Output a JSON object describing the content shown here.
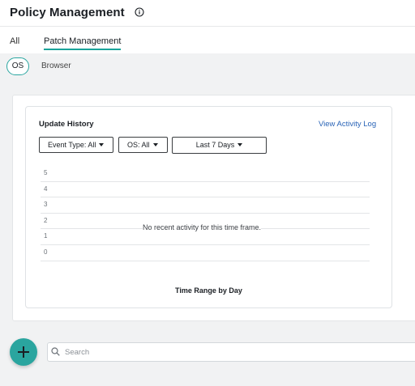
{
  "header": {
    "title": "Policy Management",
    "info_icon": "info-icon"
  },
  "tabs": [
    {
      "label": "All",
      "active": false
    },
    {
      "label": "Patch Management",
      "active": true
    }
  ],
  "subtabs": [
    {
      "label": "OS",
      "active": true
    },
    {
      "label": "Browser",
      "active": false
    }
  ],
  "update_history": {
    "title": "Update History",
    "view_activity_log": "View Activity Log",
    "filters": {
      "event_type": "Event Type: All",
      "os": "OS: All",
      "range": "Last 7 Days"
    },
    "empty_message": "No recent activity for this time frame.",
    "x_axis_title": "Time Range by Day"
  },
  "chart_data": {
    "type": "bar",
    "categories": [],
    "values": [],
    "xlabel": "Time Range by Day",
    "ylabel": "",
    "ylim": [
      0,
      5
    ],
    "yticks": [
      "5",
      "4",
      "3",
      "2",
      "1",
      "0"
    ],
    "grid": true
  },
  "fab": {
    "icon": "plus-icon"
  },
  "search": {
    "placeholder": "Search",
    "value": ""
  },
  "colors": {
    "accent": "#2aa59f",
    "link": "#2a64b7"
  }
}
